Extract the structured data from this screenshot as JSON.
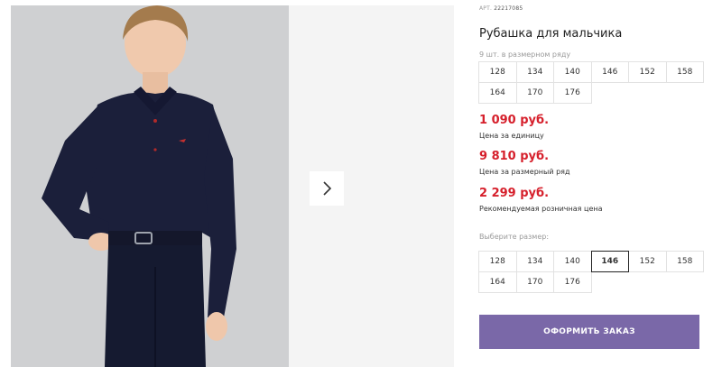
{
  "product": {
    "art_label": "АРТ.",
    "art_number": "22217085",
    "title": "Рубашка для мальчика"
  },
  "size_range": {
    "label": "9 шт. в размерном ряду",
    "sizes": [
      "128",
      "134",
      "140",
      "146",
      "152",
      "158",
      "164",
      "170",
      "176"
    ]
  },
  "prices": {
    "unit_price": "1 090 руб.",
    "unit_note": "Цена за единицу",
    "range_price": "9 810 руб.",
    "range_note": "Цена за размерный ряд",
    "retail_price": "2 299 руб.",
    "retail_note": "Рекомендуемая розничная цена"
  },
  "size_select": {
    "label": "Выберите размер:",
    "sizes": [
      "128",
      "134",
      "140",
      "146",
      "152",
      "158",
      "164",
      "170",
      "176"
    ],
    "selected": "146"
  },
  "order_button": "ОФОРМИТЬ ЗАКАЗ",
  "colors": {
    "price": "#d6202c",
    "button": "#7a68a8",
    "shirt": "#1b1f3a",
    "background": "#cfd0d2"
  },
  "icons": {
    "gallery_next": "chevron-right-icon"
  }
}
